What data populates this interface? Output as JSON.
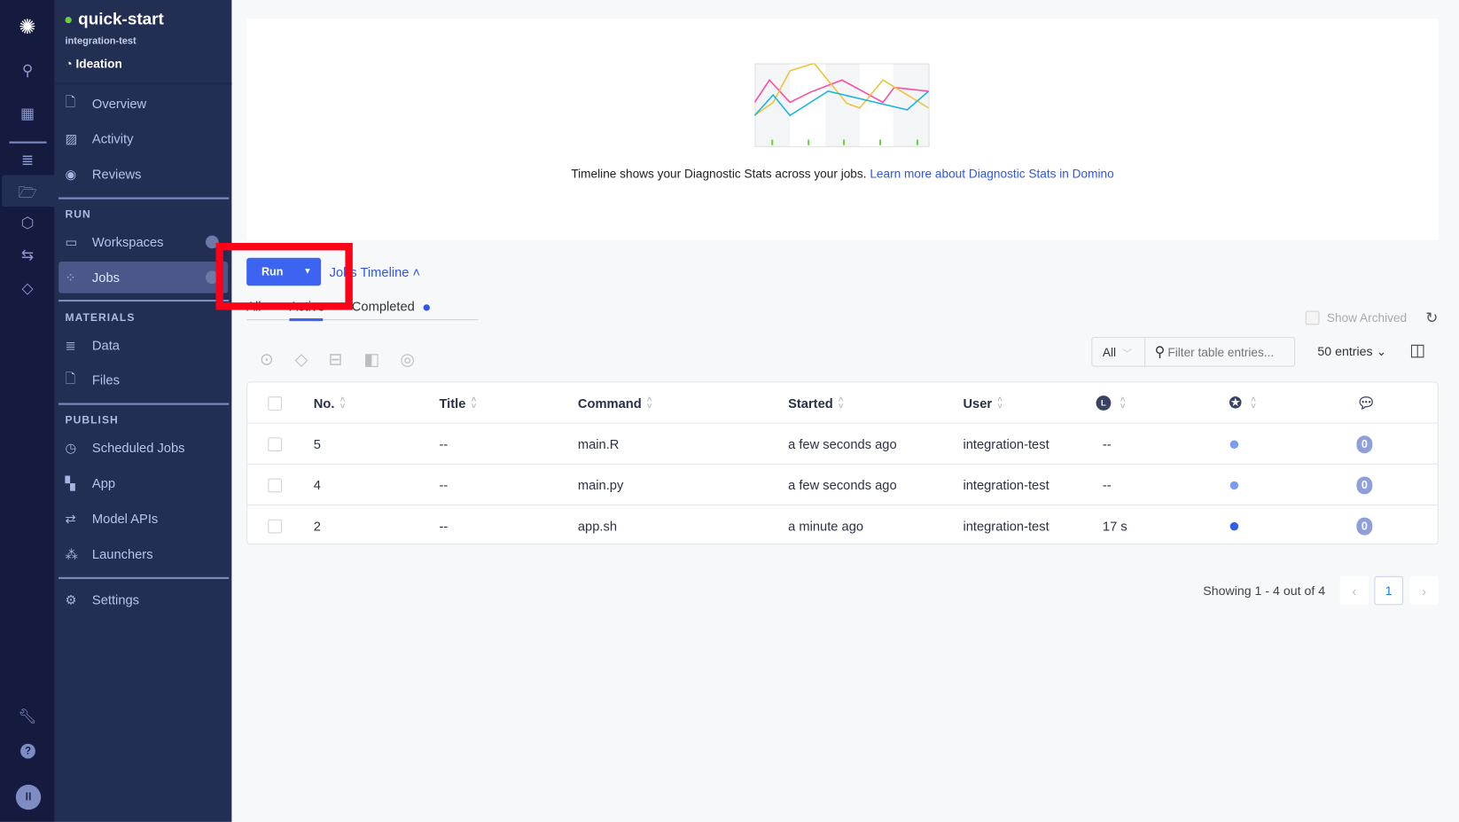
{
  "project": {
    "name": "quick-start",
    "owner": "integration-test",
    "stage": "Ideation",
    "status_color": "#6ccc3b"
  },
  "rail": {
    "icons": [
      "domino-logo-icon",
      "search-icon",
      "grid-icon",
      "database-icon",
      "folder-icon",
      "cube-icon",
      "arrows-icon",
      "tag-icon",
      "wrench-icon",
      "help-icon",
      "user-avatar-icon"
    ],
    "avatar": "II"
  },
  "sidebar": {
    "top": [
      {
        "label": "Overview",
        "icon": "overview-icon"
      },
      {
        "label": "Activity",
        "icon": "activity-icon"
      },
      {
        "label": "Reviews",
        "icon": "eye-icon"
      }
    ],
    "run_heading": "RUN",
    "run": [
      {
        "label": "Workspaces",
        "icon": "monitor-icon"
      },
      {
        "label": "Jobs",
        "icon": "jobs-icon",
        "active": true
      }
    ],
    "materials_heading": "MATERIALS",
    "materials": [
      {
        "label": "Data",
        "icon": "database-icon"
      },
      {
        "label": "Files",
        "icon": "file-icon"
      }
    ],
    "publish_heading": "PUBLISH",
    "publish": [
      {
        "label": "Scheduled Jobs",
        "icon": "clock-icon"
      },
      {
        "label": "App",
        "icon": "app-icon"
      },
      {
        "label": "Model APIs",
        "icon": "arrows-icon"
      },
      {
        "label": "Launchers",
        "icon": "launcher-icon"
      }
    ],
    "settings": {
      "label": "Settings",
      "icon": "gear-icon"
    }
  },
  "timeline": {
    "text": "Timeline shows your Diagnostic Stats across your jobs.",
    "link": "Learn more about Diagnostic Stats in Domino"
  },
  "actions": {
    "run_label": "Run",
    "timeline_toggle": "Jobs Timeline"
  },
  "tabs": [
    {
      "label": "All"
    },
    {
      "label": "Active",
      "active": true
    },
    {
      "label": "Completed"
    }
  ],
  "controls": {
    "show_archived": "Show Archived",
    "filter_select": "All",
    "filter_placeholder": "Filter table entries...",
    "entries": "50 entries"
  },
  "table": {
    "headers": [
      "No.",
      "Title",
      "Command",
      "Started",
      "User"
    ],
    "header_icons": [
      "clock-icon",
      "status-icon",
      "comments-icon"
    ],
    "rows": [
      {
        "no": "5",
        "title": "--",
        "command": "main.R",
        "started": "a few seconds ago",
        "user": "integration-test",
        "duration": "--",
        "status_color": "#7b9cf5",
        "comments": "0"
      },
      {
        "no": "4",
        "title": "--",
        "command": "main.py",
        "started": "a few seconds ago",
        "user": "integration-test",
        "duration": "--",
        "status_color": "#7b9cf5",
        "comments": "0"
      },
      {
        "no": "2",
        "title": "--",
        "command": "app.sh",
        "started": "a minute ago",
        "user": "integration-test",
        "duration": "17 s",
        "status_color": "#2f5ef0",
        "comments": "0"
      }
    ]
  },
  "pagination": {
    "summary": "Showing 1 - 4 out of 4",
    "current": "1"
  },
  "colors": {
    "accent": "#3d64f0",
    "highlight_box": "#ff0019"
  }
}
